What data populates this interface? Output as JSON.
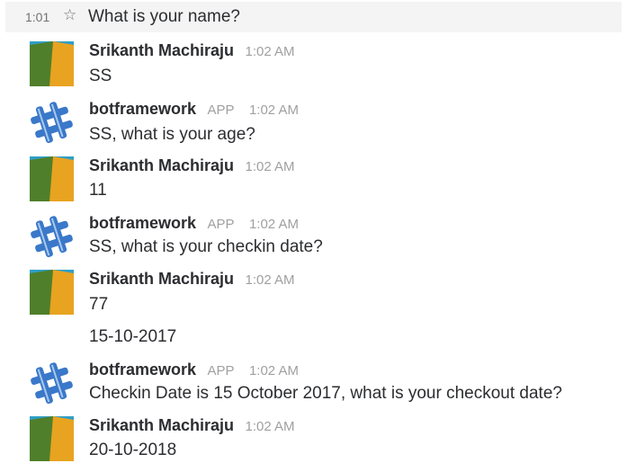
{
  "hover_message": {
    "time": "1:01",
    "star_icon": "star-outline-icon",
    "text": "What is your name?"
  },
  "messages": [
    {
      "sender": "Srikanth Machiraju",
      "timestamp": "1:02 AM",
      "text": "SS",
      "avatar": "user-avatar-icon"
    },
    {
      "sender": "botframework",
      "badge": "APP",
      "timestamp": "1:02 AM",
      "text": "SS, what is your age?",
      "avatar": "bot-avatar-icon"
    },
    {
      "sender": "Srikanth Machiraju",
      "timestamp": "1:02 AM",
      "text": "11",
      "avatar": "user-avatar-icon"
    },
    {
      "sender": "botframework",
      "badge": "APP",
      "timestamp": "1:02 AM",
      "text": "SS, what is your checkin date?",
      "avatar": "bot-avatar-icon"
    },
    {
      "sender": "Srikanth Machiraju",
      "timestamp": "1:02 AM",
      "text": "77",
      "text2": "15-10-2017",
      "avatar": "user-avatar-icon"
    },
    {
      "sender": "botframework",
      "badge": "APP",
      "timestamp": "1:02 AM",
      "text": "Checkin Date is 15 October 2017, what is your checkout date?",
      "avatar": "bot-avatar-icon"
    },
    {
      "sender": "Srikanth Machiraju",
      "timestamp": "1:02 AM",
      "text": "20-10-2018",
      "avatar": "user-avatar-icon"
    }
  ],
  "colors": {
    "hover_background": "#f4f4f4",
    "user_avatar_green": "#4f7f2a",
    "user_avatar_orange": "#e8a321",
    "user_avatar_teal": "#2f9fc7",
    "bot_avatar_blue": "#3a78c9",
    "timestamp_gray": "#a0a0a2"
  }
}
